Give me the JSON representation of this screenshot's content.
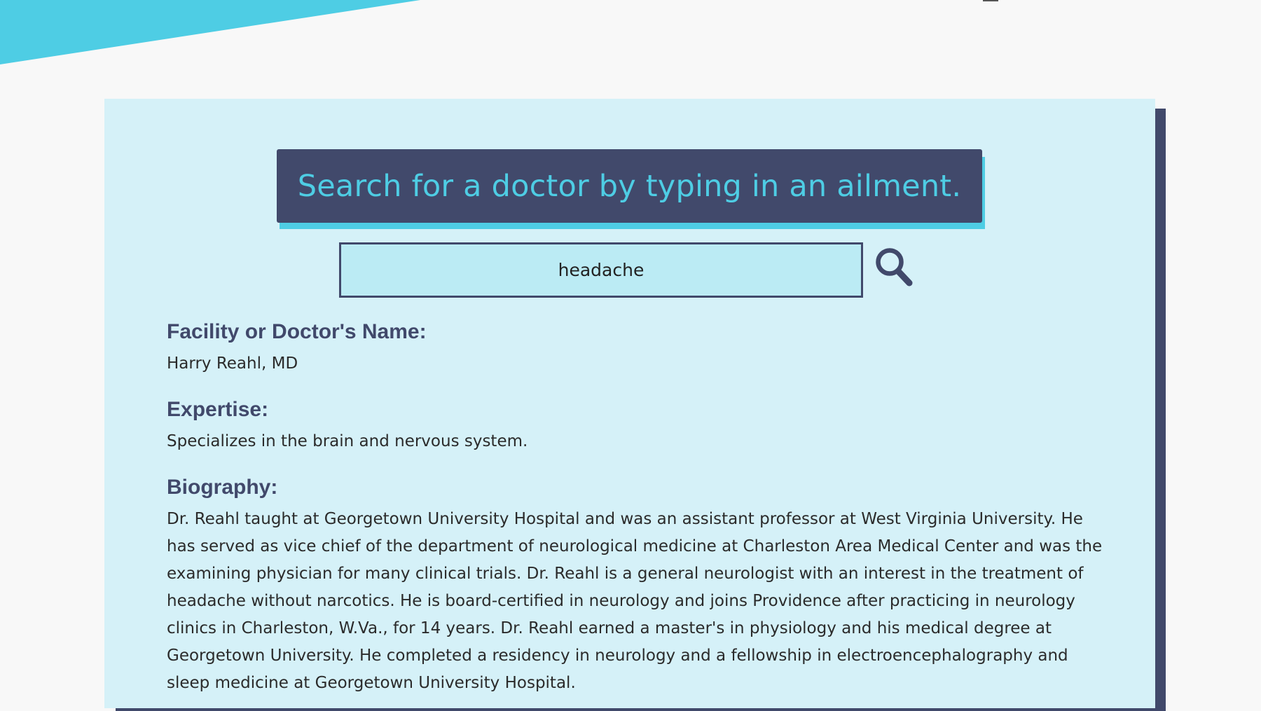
{
  "search": {
    "banner_text": "Search for a doctor by typing in an ailment.",
    "query": "headache"
  },
  "result": {
    "name_label": "Facility or Doctor's Name:",
    "name_value": "Harry Reahl, MD",
    "expertise_label": "Expertise:",
    "expertise_value": "Specializes in the brain and nervous system.",
    "biography_label": "Biography:",
    "biography_value": "Dr. Reahl taught at Georgetown University Hospital and was an assistant professor at West Virginia University. He has served as vice chief of the department of neurological medicine at Charleston Area Medical Center and was the examining physician for many clinical trials. Dr. Reahl is a general neurologist with an interest in the treatment of headache without narcotics. He is board-certified in neurology and joins Providence after practicing in neurology clinics in Charleston, W.Va., for 14 years. Dr. Reahl earned a master's in physiology and his medical degree at Georgetown University. He completed a residency in neurology and a fellowship in electroencephalography and sleep medicine at Georgetown University Hospital."
  },
  "colors": {
    "accent": "#4ecde4",
    "navy": "#41496b",
    "card_background": "#d5f1f8",
    "input_background": "#bbebf4"
  },
  "icons": {
    "search": "search-icon"
  }
}
